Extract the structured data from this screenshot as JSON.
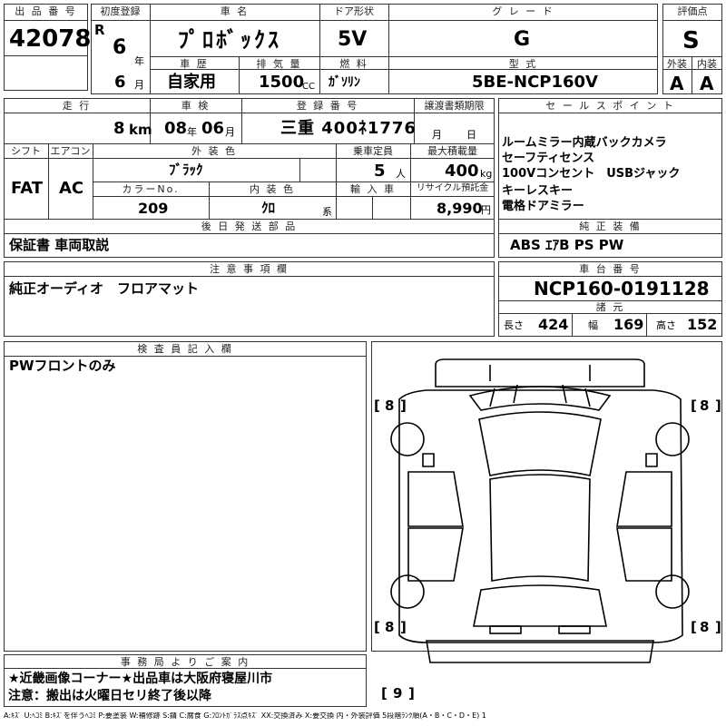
{
  "header": {
    "lot_no_label": "出 品 番 号",
    "lot_no": "42078",
    "first_reg_label": "初度登録",
    "era": "R",
    "reg_year": "6",
    "year_unit": "年",
    "reg_month": "6",
    "month_unit": "月",
    "car_name_label": "車 名",
    "car_name": "ﾌﾟﾛﾎﾞｯｸｽ",
    "doors_label": "ドア形状",
    "doors": "5V",
    "grade_label": "グ レ ー ド",
    "grade": "G",
    "score_label": "評価点",
    "score": "S",
    "history_label": "車 歴",
    "history": "自家用",
    "displacement_label": "排 気 量",
    "displacement": "1500",
    "displacement_unit": "CC",
    "fuel_label": "燃 料",
    "fuel": "ｶﾞｿﾘﾝ",
    "model_label": "型 式",
    "model": "5BE-NCP160V",
    "exterior_label": "外装",
    "exterior": "A",
    "interior_label": "内装",
    "interior": "A"
  },
  "details": {
    "mileage_label": "走 行",
    "mileage": "8",
    "mileage_unit": "km",
    "inspection_label": "車 検",
    "inspection_year": "08",
    "inspection_month": "06",
    "year_unit": "年",
    "month_unit": "月",
    "plate_label": "登 録 番 号",
    "plate": "三重 400ﾈ1776",
    "transfer_label": "譲渡書類期限",
    "transfer_month_unit": "月",
    "transfer_day_unit": "日",
    "shift_label": "シフト",
    "shift": "FAT",
    "ac_label": "エアコン",
    "ac": "AC",
    "color_label": "外 装 色",
    "color": "ﾌﾞﾗｯｸ",
    "capacity_label": "乗車定員",
    "capacity": "5",
    "capacity_unit": "人",
    "max_load_label": "最大積載量",
    "max_load": "400",
    "max_load_unit": "kg",
    "color_no_label": "カラーNo.",
    "color_no": "209",
    "interior_color_label": "内 装 色",
    "interior_color": "ｸﾛ",
    "interior_color_unit": "系",
    "import_label": "輸 入 車",
    "recycle_label": "リサイクル預託金",
    "recycle": "8,990",
    "recycle_unit": "円",
    "later_parts_label": "後 日 発 送 部 品",
    "later_parts": "保証書 車両取説"
  },
  "sales_points": {
    "label": "セ ー ル ス ポ イ ン ト",
    "items": [
      "ルームミラー内蔵バックカメラ",
      "セーフティセンス",
      "100Vコンセント　USBジャック",
      "キーレスキー",
      "電格ドアミラー"
    ],
    "equipment_label": "純 正 装 備",
    "equipment": "ABS ｴｱB PS PW"
  },
  "notes": {
    "label": "注 意 事 項 欄",
    "text": "純正オーディオ　フロアマット"
  },
  "chassis": {
    "label": "車 台 番 号",
    "number": "NCP160-0191128",
    "dims_label": "諸 元",
    "length_label": "長さ",
    "length": "424",
    "width_label": "幅",
    "width": "169",
    "height_label": "高さ",
    "height": "152"
  },
  "inspector": {
    "label": "検 査 員 記 入 欄",
    "text": "PWフロントのみ"
  },
  "diagram": {
    "tire_fl": "8",
    "tire_fr": "8",
    "tire_rl": "8",
    "tire_rr": "8",
    "spare": "9"
  },
  "office": {
    "label": "事 務 局 よ り ご 案 内",
    "line1": "★近畿画像コーナー★出品車は大阪府寝屋川市",
    "line2": "注意：搬出は火曜日セリ終了後以降"
  },
  "legend": "A:ｷｽﾞ U:ﾍｺﾐ B:ｷｽﾞを伴うﾍｺﾐ P:要塗装 W:補修跡 S:錆 C:腐食 G:ﾌﾛﾝﾄｶﾞﾗｽ点ｷｽﾞ XX:交換済み X:要交換 内・外装評価 5段階ﾗﾝｸ順(A・B・C・D・E) 1"
}
